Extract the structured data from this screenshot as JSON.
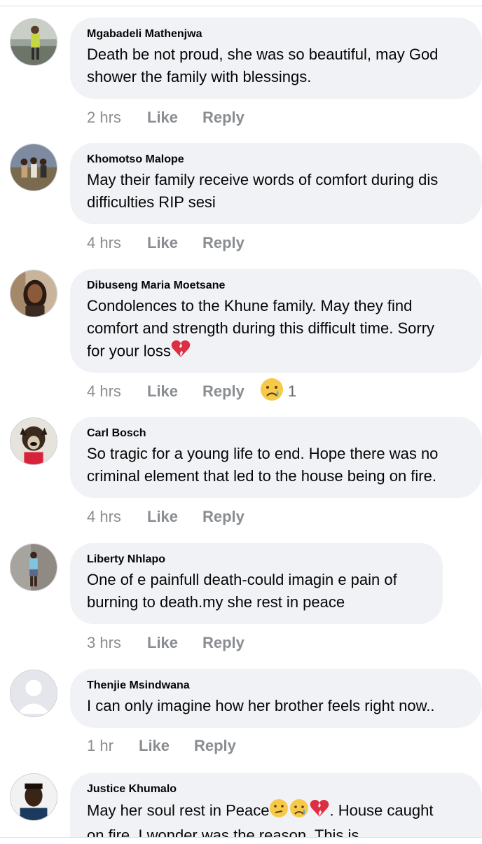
{
  "comments": [
    {
      "author": "Mgabadeli Mathenjwa",
      "lines": [
        "Death be not proud, she was so beautiful, may God",
        "shower the family with blessings."
      ],
      "time": "2 hrs",
      "like": "Like",
      "reply": "Reply",
      "avatar": "person-outdoor-photo"
    },
    {
      "author": "Khomotso Malope",
      "lines": [
        "May their family receive words of comfort during dis",
        "difficulties RIP sesi"
      ],
      "time": "4 hrs",
      "like": "Like",
      "reply": "Reply",
      "avatar": "group-photo"
    },
    {
      "author": "Dibuseng Maria Moetsane",
      "lines": [
        "Condolences to the Khune family. May they find",
        "comfort and strength during this difficult time. Sorry",
        "for your loss"
      ],
      "trailing_emoji": "broken-heart-icon",
      "time": "4 hrs",
      "like": "Like",
      "reply": "Reply",
      "reaction": {
        "icon": "sad-face-icon",
        "count": "1"
      },
      "avatar": "woman-portrait"
    },
    {
      "author": "Carl Bosch",
      "lines": [
        "So tragic for a young life to end. Hope there was no",
        "criminal element that led to the house being on fire."
      ],
      "time": "4 hrs",
      "like": "Like",
      "reply": "Reply",
      "avatar": "dog-photo"
    },
    {
      "author": "Liberty Nhlapo",
      "lines": [
        "One of e painfull death-could imagin e pain of",
        "burning to death.my she rest in peace"
      ],
      "time": "3 hrs",
      "like": "Like",
      "reply": "Reply",
      "avatar": "man-standing-photo"
    },
    {
      "author": "Thenjie Msindwana",
      "lines": [
        "I can only imagine how her brother feels right now.."
      ],
      "time": "1 hr",
      "like": "Like",
      "reply": "Reply",
      "avatar": "default-silhouette"
    },
    {
      "author": "Justice Khumalo",
      "lines": [
        "May her soul rest in Peace",
        "on fire. I wonder was the reason. This is"
      ],
      "line1_suffix": ". House caught",
      "time": "",
      "like": "",
      "reply": "",
      "avatar": "man-portrait"
    }
  ],
  "colors": {
    "bubble": "#f0f2f5",
    "meta": "#8a8d91",
    "text": "#050505"
  }
}
